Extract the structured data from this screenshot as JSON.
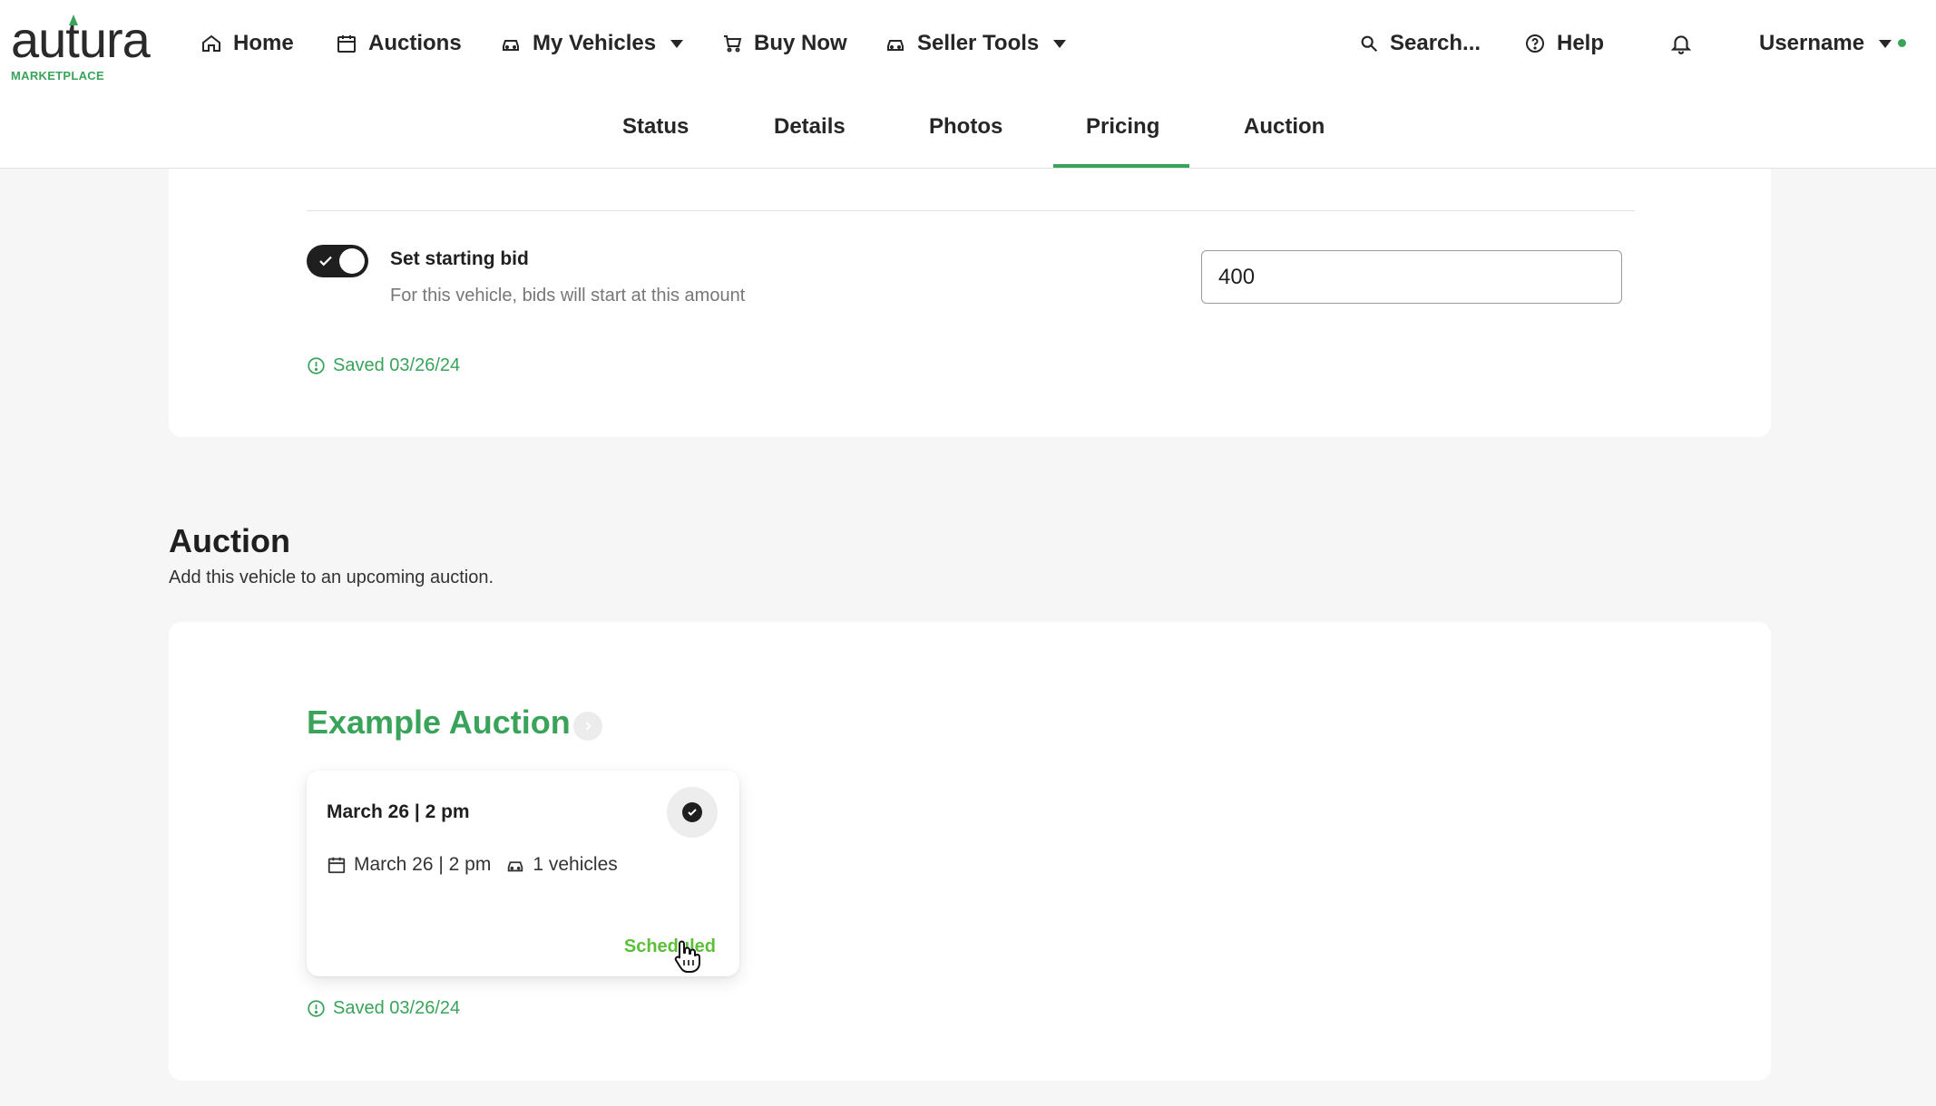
{
  "brand": {
    "name": "autura",
    "tagline": "MARKETPLACE",
    "accent": "#39a35a"
  },
  "nav": {
    "home": "Home",
    "auctions": "Auctions",
    "my_vehicles": "My Vehicles",
    "buy_now": "Buy Now",
    "seller_tools": "Seller Tools",
    "search": "Search...",
    "help": "Help",
    "username": "Username"
  },
  "tabs": {
    "status": "Status",
    "details": "Details",
    "photos": "Photos",
    "pricing": "Pricing",
    "auction": "Auction",
    "active": "Pricing"
  },
  "pricing": {
    "starting_bid_toggle": true,
    "starting_bid_label": "Set starting bid",
    "starting_bid_desc": "For this vehicle, bids will start at this amount",
    "starting_bid_value": "400",
    "saved_text": "Saved 03/26/24"
  },
  "auction_section": {
    "title": "Auction",
    "subtitle": "Add this vehicle to an upcoming auction.",
    "auction_name": "Example Auction",
    "slot": {
      "title": "March 26 | 2 pm",
      "date": "March 26 | 2 pm",
      "vehicles": "1 vehicles",
      "status": "Scheduled",
      "selected": true
    },
    "saved_text": "Saved 03/26/24"
  },
  "icons": [
    "home-icon",
    "calendar-icon",
    "car-icon",
    "cart-icon",
    "search-icon",
    "help-icon",
    "bell-icon",
    "check-icon",
    "info-icon",
    "chevron-right-icon"
  ]
}
